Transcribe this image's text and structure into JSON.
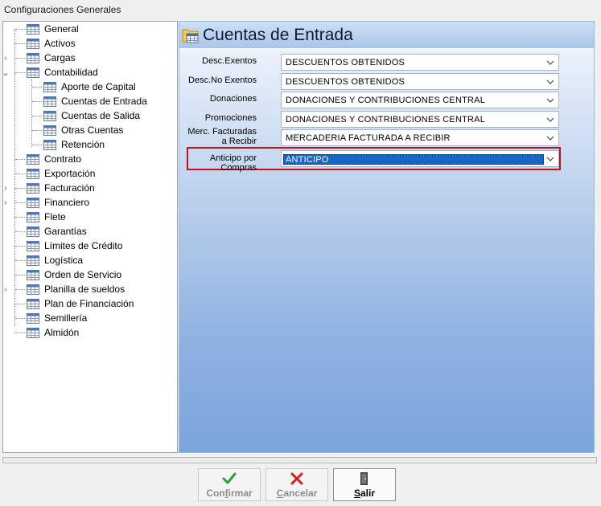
{
  "window": {
    "title": "Configuraciones Generales"
  },
  "tree": {
    "items": [
      {
        "label": "General",
        "level": 0,
        "expander": ""
      },
      {
        "label": "Activos",
        "level": 0,
        "expander": ""
      },
      {
        "label": "Cargas",
        "level": 0,
        "expander": ">"
      },
      {
        "label": "Contabilidad",
        "level": 0,
        "expander": "v"
      },
      {
        "label": "Aporte de Capital",
        "level": 1,
        "expander": ""
      },
      {
        "label": "Cuentas de Entrada",
        "level": 1,
        "expander": ""
      },
      {
        "label": "Cuentas de Salida",
        "level": 1,
        "expander": ""
      },
      {
        "label": "Otras Cuentas",
        "level": 1,
        "expander": ""
      },
      {
        "label": "Retención",
        "level": 1,
        "expander": ""
      },
      {
        "label": "Contrato",
        "level": 0,
        "expander": ""
      },
      {
        "label": "Exportación",
        "level": 0,
        "expander": ""
      },
      {
        "label": "Facturación",
        "level": 0,
        "expander": ">"
      },
      {
        "label": "Financiero",
        "level": 0,
        "expander": ">"
      },
      {
        "label": "Flete",
        "level": 0,
        "expander": ""
      },
      {
        "label": "Garantías",
        "level": 0,
        "expander": ""
      },
      {
        "label": "Límites de Crédito",
        "level": 0,
        "expander": ""
      },
      {
        "label": "Logística",
        "level": 0,
        "expander": ""
      },
      {
        "label": "Orden de Servicio",
        "level": 0,
        "expander": ""
      },
      {
        "label": "Planilla de sueldos",
        "level": 0,
        "expander": ">"
      },
      {
        "label": "Plan de Financiación",
        "level": 0,
        "expander": ""
      },
      {
        "label": "Semillería",
        "level": 0,
        "expander": ""
      },
      {
        "label": "Almidón",
        "level": 0,
        "expander": ""
      }
    ]
  },
  "main": {
    "title": "Cuentas de Entrada",
    "fields": [
      {
        "label": "Desc.Exentos",
        "value": "DESCUENTOS OBTENIDOS"
      },
      {
        "label": "Desc.No Exentos",
        "value": "DESCUENTOS OBTENIDOS"
      },
      {
        "label": "Donaciones",
        "value": "DONACIONES Y CONTRIBUCIONES CENTRAL"
      },
      {
        "label": "Promociones",
        "value": "DONACIONES Y CONTRIBUCIONES CENTRAL"
      },
      {
        "label_line1": "Merc. Facturadas",
        "label_line2": "a Recibir",
        "value": "MERCADERIA FACTURADA A RECIBIR"
      },
      {
        "label": "Anticipo por Compras",
        "value": "ANTICIPO"
      }
    ]
  },
  "buttons": {
    "confirm": {
      "label": "Confirmar",
      "mnemonic": "f",
      "pre": "Con",
      "post": "irmar"
    },
    "cancel": {
      "label": "Cancelar",
      "mnemonic": "C",
      "pre": "",
      "post": "ancelar"
    },
    "exit": {
      "label": "Salir",
      "mnemonic": "S",
      "pre": "",
      "post": "alir"
    }
  },
  "colors": {
    "accent_selection": "#1566c9",
    "highlight_border": "#c0101a",
    "confirm_icon": "#2e9e2e",
    "cancel_icon": "#d81c1c"
  }
}
